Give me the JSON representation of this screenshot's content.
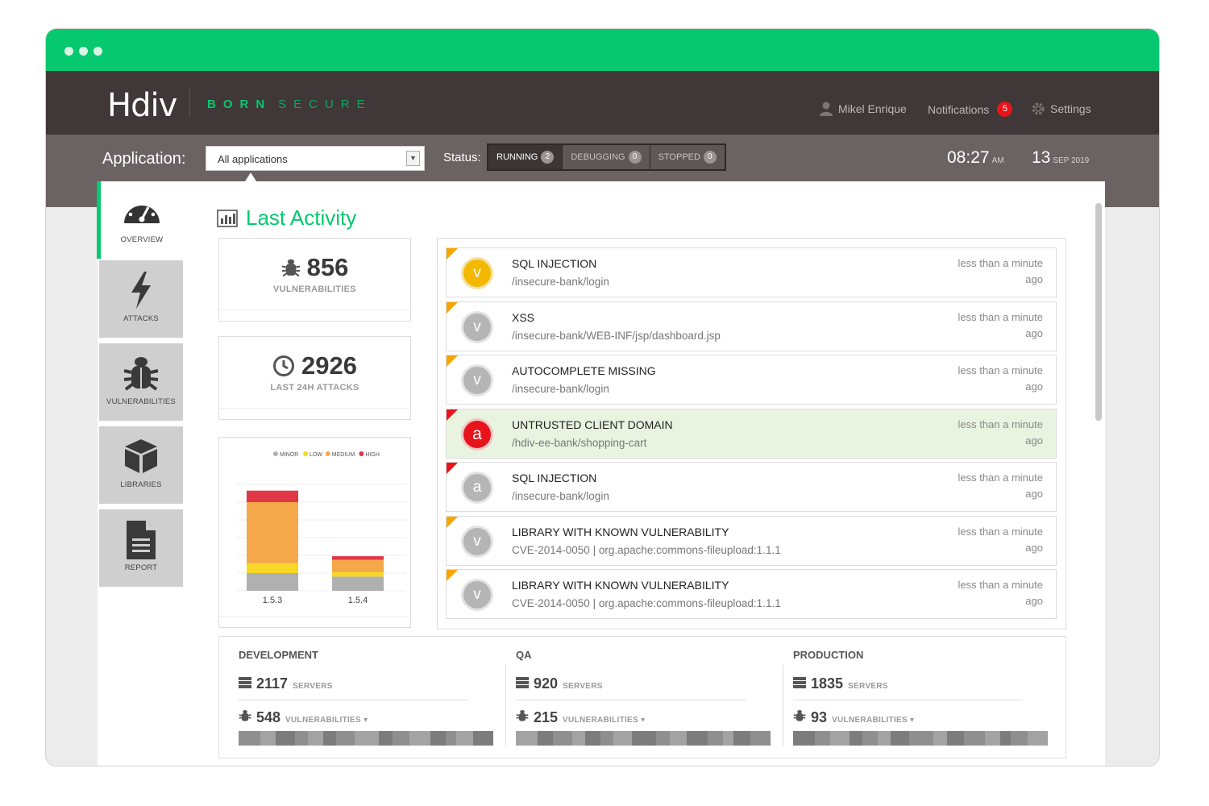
{
  "brand": {
    "logo": "Hdiv",
    "tagline_1": "BORN",
    "tagline_2": "SECURE"
  },
  "header": {
    "user": "Mikel Enrique",
    "notifications_label": "Notifications",
    "notifications_count": "5",
    "settings_label": "Settings"
  },
  "appbar": {
    "application_label": "Application:",
    "application_value": "All applications",
    "status_label": "Status:",
    "statuses": [
      {
        "label": "RUNNING",
        "count": "2"
      },
      {
        "label": "DEBUGGING",
        "count": "0"
      },
      {
        "label": "STOPPED",
        "count": "0"
      }
    ],
    "time": "08:27",
    "time_suffix": "AM",
    "day": "13",
    "month_year": "SEP 2019"
  },
  "sidebar": {
    "items": [
      {
        "label": "OVERVIEW",
        "icon": "gauge-icon"
      },
      {
        "label": "ATTACKS",
        "icon": "lightning-icon"
      },
      {
        "label": "VULNERABILITIES",
        "icon": "bug-icon"
      },
      {
        "label": "LIBRARIES",
        "icon": "box-icon"
      },
      {
        "label": "REPORT",
        "icon": "document-icon"
      }
    ]
  },
  "main": {
    "title": "Last Activity",
    "stats": [
      {
        "value": "856",
        "label": "VULNERABILITIES"
      },
      {
        "value": "2926",
        "label": "LAST 24H ATTACKS"
      }
    ]
  },
  "chart_data": {
    "type": "bar",
    "stacked": true,
    "categories": [
      "1.5.3",
      "1.5.4"
    ],
    "legend": [
      "MINOR",
      "LOW",
      "MEDIUM",
      "HIGH"
    ],
    "legend_position": "top-right",
    "series": [
      {
        "name": "MINOR",
        "color": "#b0b0b0",
        "values": [
          20,
          16
        ]
      },
      {
        "name": "LOW",
        "color": "#f7d827",
        "values": [
          11,
          5
        ]
      },
      {
        "name": "MEDIUM",
        "color": "#f4a849",
        "values": [
          69,
          14
        ]
      },
      {
        "name": "HIGH",
        "color": "#e23746",
        "values": [
          13,
          4
        ]
      }
    ],
    "grid": true
  },
  "activity": [
    {
      "title": "SQL INJECTION",
      "path": "/insecure-bank/login",
      "ago_1": "less than a minute",
      "ago_2": "ago",
      "letter": "v",
      "circle": "yellow",
      "corner": "orange",
      "highlight": false
    },
    {
      "title": "XSS",
      "path": "/insecure-bank/WEB-INF/jsp/dashboard.jsp",
      "ago_1": "less than a minute",
      "ago_2": "ago",
      "letter": "v",
      "circle": "grey",
      "corner": "orange",
      "highlight": false
    },
    {
      "title": "AUTOCOMPLETE MISSING",
      "path": "/insecure-bank/login",
      "ago_1": "less than a minute",
      "ago_2": "ago",
      "letter": "v",
      "circle": "grey",
      "corner": "orange",
      "highlight": false
    },
    {
      "title": "UNTRUSTED CLIENT DOMAIN",
      "path": "/hdiv-ee-bank/shopping-cart",
      "ago_1": "less than a minute",
      "ago_2": "ago",
      "letter": "a",
      "circle": "red",
      "corner": "red",
      "highlight": true
    },
    {
      "title": "SQL INJECTION",
      "path": "/insecure-bank/login",
      "ago_1": "less than a minute",
      "ago_2": "ago",
      "letter": "a",
      "circle": "grey",
      "corner": "red",
      "highlight": false
    },
    {
      "title": "LIBRARY WITH KNOWN VULNERABILITY",
      "path": "CVE-2014-0050 | org.apache:commons-fileupload:1.1.1",
      "ago_1": "less than a minute",
      "ago_2": "ago",
      "letter": "v",
      "circle": "grey",
      "corner": "orange",
      "highlight": false
    },
    {
      "title": "LIBRARY WITH KNOWN VULNERABILITY",
      "path": "CVE-2014-0050 | org.apache:commons-fileupload:1.1.1",
      "ago_1": "less than a minute",
      "ago_2": "ago",
      "letter": "v",
      "circle": "grey",
      "corner": "orange",
      "highlight": false
    }
  ],
  "environments": [
    {
      "name": "DEVELOPMENT",
      "servers": "2117",
      "servers_label": "SERVERS",
      "vulnerabilities": "548",
      "vulnerabilities_label": "VULNERABILITIES ▾"
    },
    {
      "name": "QA",
      "servers": "920",
      "servers_label": "SERVERS",
      "vulnerabilities": "215",
      "vulnerabilities_label": "VULNERABILITIES ▾"
    },
    {
      "name": "PRODUCTION",
      "servers": "1835",
      "servers_label": "SERVERS",
      "vulnerabilities": "93",
      "vulnerabilities_label": "VULNERABILITIES ▾"
    }
  ],
  "colors": {
    "accent": "#06c86e",
    "topbar": "#3f3738",
    "appbar": "#6b6263",
    "alert": "#e8141b",
    "warning": "#f6a600"
  }
}
